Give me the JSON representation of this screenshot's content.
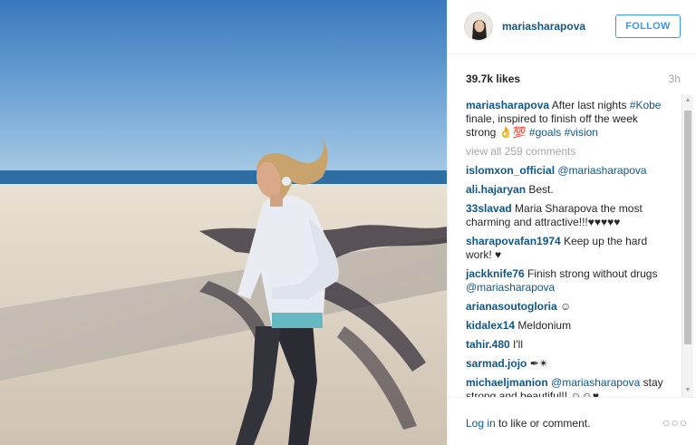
{
  "post": {
    "username": "mariasharapova",
    "follow_label": "FOLLOW",
    "likes": "39.7k likes",
    "age": "3h",
    "caption": {
      "user": "mariasharapova",
      "text_1": " After last nights ",
      "tag_1": "#Kobe",
      "text_2": " finale, inspired to finish off the week strong 👌💯 ",
      "tag_2": "#goals",
      "text_3": " ",
      "tag_3": "#vision"
    },
    "view_all": "view all 259 comments",
    "comments": [
      {
        "user": "islomxon_official",
        "text": " ",
        "mention": "@mariasharapova"
      },
      {
        "user": "ali.hajaryan",
        "text": " Best."
      },
      {
        "user": "33slavad",
        "text": " Maria Sharapova the most charming and attractive!!!♥♥♥♥♥"
      },
      {
        "user": "sharapovafan1974",
        "text": " Keep up the hard work! ♥"
      },
      {
        "user": "jackknife76",
        "text": " Finish strong without drugs ",
        "mention": "@mariasharapova"
      },
      {
        "user": "arianasoutogloria",
        "text": " ☺"
      },
      {
        "user": "kidalex14",
        "text": " Meldonium"
      },
      {
        "user": "tahir.480",
        "text": " I'll"
      },
      {
        "user": "sarmad.jojo",
        "text": " ✒✴"
      },
      {
        "user": "michaeljmanion",
        "text": " ",
        "mention": "@mariasharapova",
        "text_after": " stay strong and beautiful!! ☺☺♥"
      }
    ]
  },
  "footer": {
    "login_link": "Log in",
    "login_text": " to like or comment."
  },
  "icons": {
    "more": "more-options-icon",
    "scroll_up": "scroll-up-arrow-icon",
    "scroll_down": "scroll-down-arrow-icon"
  },
  "colors": {
    "link": "#125688",
    "follow": "#3897f0",
    "muted": "#a5a7aa",
    "sky": "#3e7cbf",
    "sand": "#dcd3c6"
  }
}
